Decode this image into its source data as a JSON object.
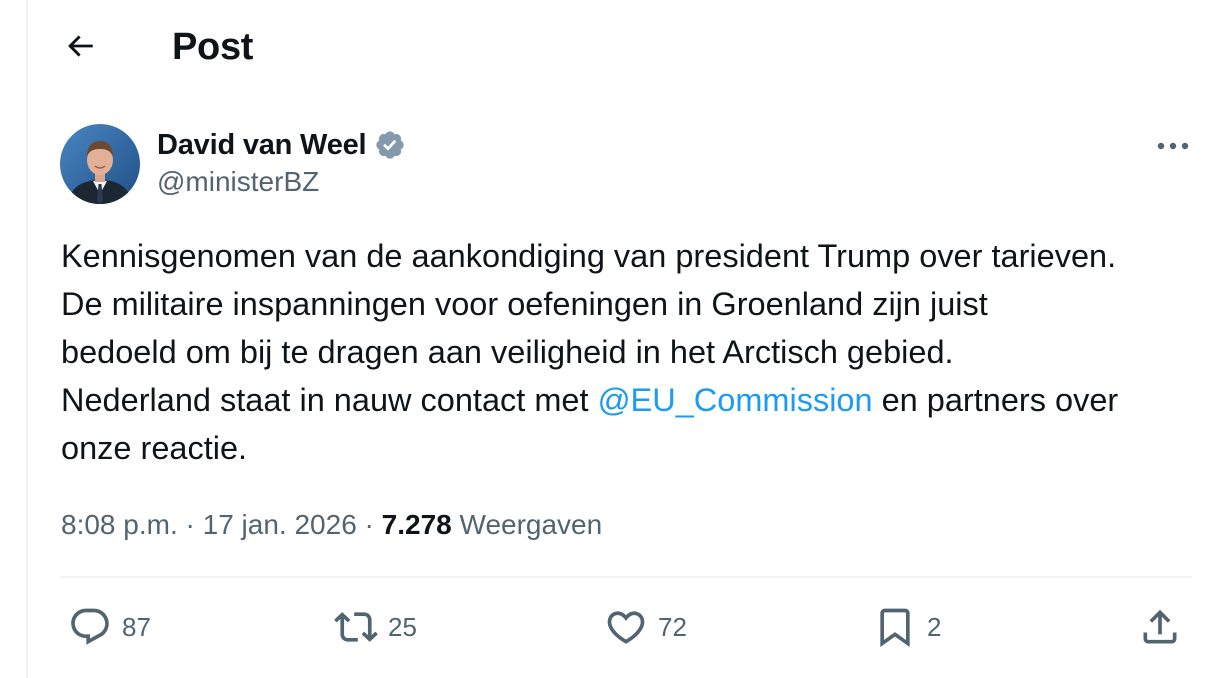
{
  "header": {
    "title": "Post",
    "back_icon": "arrow-left-icon"
  },
  "author": {
    "name": "David van Weel",
    "handle": "@ministerBZ",
    "verified": true,
    "verified_color": "#829aab"
  },
  "tweet": {
    "lines": [
      "Kennisgenomen van de aankondiging van president Trump over tarieven.",
      "De militaire inspanningen voor oefeningen in Groenland zijn juist",
      "bedoeld om bij te dragen aan veiligheid in het Arctisch gebied."
    ],
    "line4_before": "Nederland staat in nauw contact met ",
    "mention": "@EU_Commission",
    "line4_after": " en partners over",
    "line5": "onze reactie."
  },
  "meta": {
    "time": "8:08 p.m.",
    "separator": "·",
    "date": "17 jan. 2026",
    "views_count": "7.278",
    "views_label": "Weergaven"
  },
  "actions": {
    "replies": "87",
    "reposts": "25",
    "likes": "72",
    "bookmarks": "2"
  },
  "colors": {
    "text": "#0f1419",
    "secondary": "#536471",
    "link": "#1d9bf0",
    "divider": "#eff3f4"
  }
}
